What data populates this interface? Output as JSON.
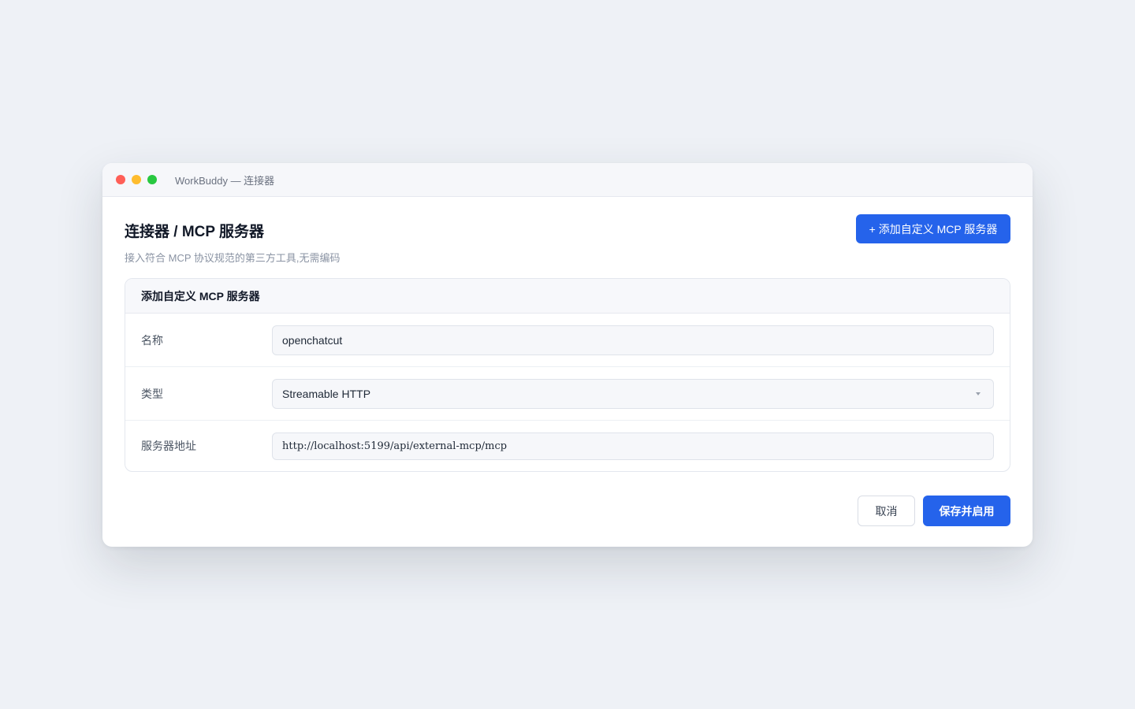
{
  "window": {
    "title": "WorkBuddy — 连接器",
    "lights": [
      "close",
      "minimize",
      "zoom"
    ]
  },
  "header": {
    "title": "连接器 / MCP 服务器",
    "subtitle": "接入符合 MCP 协议规范的第三方工具,无需编码",
    "add_button": "+ 添加自定义 MCP 服务器"
  },
  "form": {
    "card_title": "添加自定义 MCP 服务器",
    "name": {
      "label": "名称",
      "value": "openchatcut"
    },
    "type": {
      "label": "类型",
      "value": "Streamable HTTP"
    },
    "url": {
      "label": "服务器地址",
      "value": "http://localhost:5199/api/external-mcp/mcp"
    }
  },
  "footer": {
    "cancel": "取消",
    "save": "保存并启用"
  },
  "colors": {
    "accent": "#2563eb",
    "background": "#eef1f6"
  }
}
